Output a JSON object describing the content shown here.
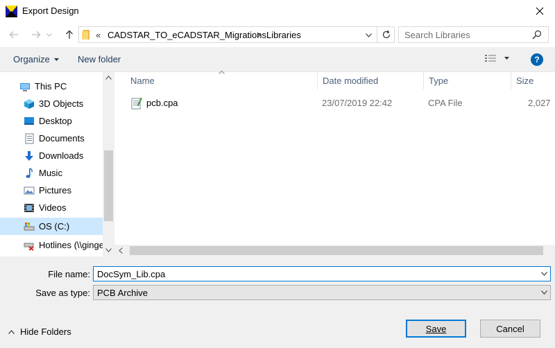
{
  "window": {
    "title": "Export Design"
  },
  "address": {
    "overflow": "«",
    "segments": [
      "CADSTAR_TO_eCADSTAR_Migrations",
      "Libraries"
    ],
    "separator": ">"
  },
  "search": {
    "placeholder": "Search Libraries"
  },
  "toolbar": {
    "organize_label": "Organize",
    "new_folder_label": "New folder",
    "help_label": "?"
  },
  "nav": {
    "items": [
      {
        "label": "This PC",
        "icon": "computer-icon"
      },
      {
        "label": "3D Objects",
        "icon": "cube-icon"
      },
      {
        "label": "Desktop",
        "icon": "desktop-icon"
      },
      {
        "label": "Documents",
        "icon": "document-icon"
      },
      {
        "label": "Downloads",
        "icon": "download-icon"
      },
      {
        "label": "Music",
        "icon": "music-icon"
      },
      {
        "label": "Pictures",
        "icon": "picture-icon"
      },
      {
        "label": "Videos",
        "icon": "video-icon"
      },
      {
        "label": "OS (C:)",
        "icon": "drive-icon"
      },
      {
        "label": "Hotlines (\\\\ginge",
        "icon": "network-drive-icon"
      }
    ]
  },
  "columns": {
    "name": "Name",
    "date": "Date modified",
    "type": "Type",
    "size": "Size"
  },
  "files": [
    {
      "name": "pcb.cpa",
      "date": "23/07/2019 22:42",
      "type": "CPA File",
      "size": "2,027"
    }
  ],
  "form": {
    "filename_label": "File name:",
    "filename_value": "DocSym_Lib.cpa",
    "savetype_label": "Save as type:",
    "savetype_value": "PCB Archive"
  },
  "footer": {
    "hide_folders_label": "Hide Folders",
    "save_label": "Save",
    "cancel_label": "Cancel"
  },
  "colors": {
    "accent": "#0078d7",
    "selection": "#cce8ff",
    "help": "#0063b1"
  }
}
